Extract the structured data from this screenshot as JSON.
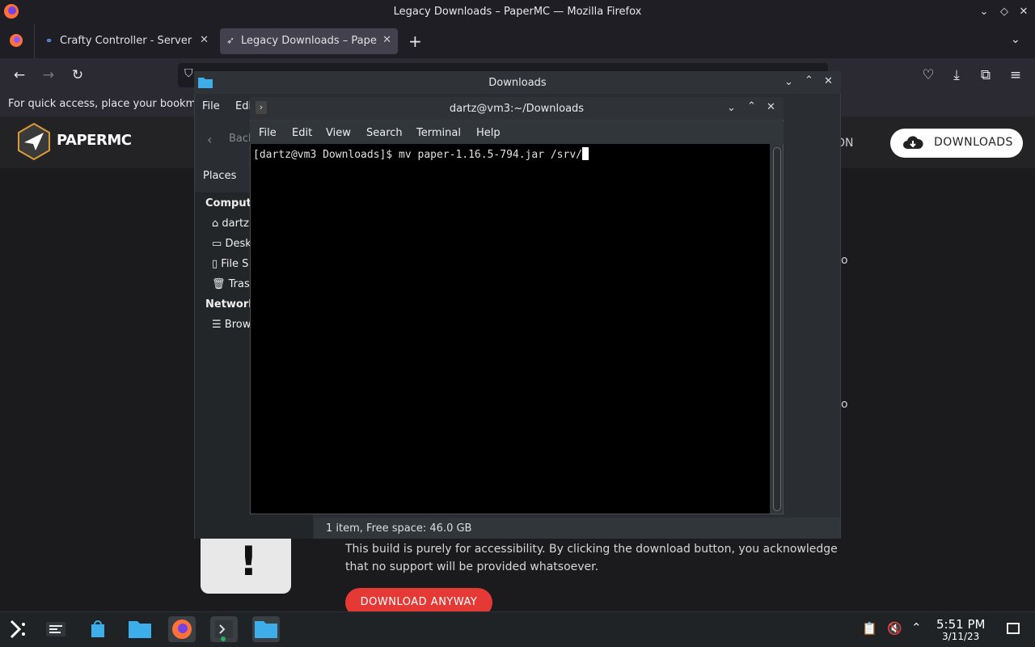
{
  "firefox": {
    "window_title": "Legacy Downloads – PaperMC — Mozilla Firefox",
    "tabs": [
      {
        "label": "Crafty Controller - Server D"
      },
      {
        "label": "Legacy Downloads – Paper"
      }
    ],
    "new_tab": "+",
    "bookmarks_message": "For quick access, place your bookma"
  },
  "site": {
    "logo_text": "PAPERMC",
    "nav_partial": "ON",
    "download_button": "DOWNLOADS",
    "partial_o1": "o",
    "partial_o2": "o",
    "warning_text": "This build is purely for accessibility. By clicking the download button, you acknowledge that no support will be provided whatsoever.",
    "download_anyway": "DOWNLOAD ANYWAY",
    "warning_mark": "!"
  },
  "dolphin": {
    "title": "Downloads",
    "menu": [
      "File",
      "Edi"
    ],
    "back": "Back",
    "places_label": "Places",
    "sections": [
      {
        "label": "Compute",
        "items": [
          "dartz",
          "Desk",
          "File S",
          "Trash"
        ]
      },
      {
        "label": "Network",
        "items": [
          "Brow"
        ]
      }
    ],
    "status": "1 item, Free space: 46.0 GB"
  },
  "konsole": {
    "title": "dartz@vm3:~/Downloads",
    "menu": [
      "File",
      "Edit",
      "View",
      "Search",
      "Terminal",
      "Help"
    ],
    "prompt_line": "[dartz@vm3 Downloads]$ mv paper-1.16.5-794.jar /srv/"
  },
  "taskbar": {
    "time": "5:51 PM",
    "date": "3/11/23"
  },
  "colors": {
    "accent_red": "#e53935",
    "terminal_bg": "#000000",
    "folder_blue": "#3daee9"
  }
}
